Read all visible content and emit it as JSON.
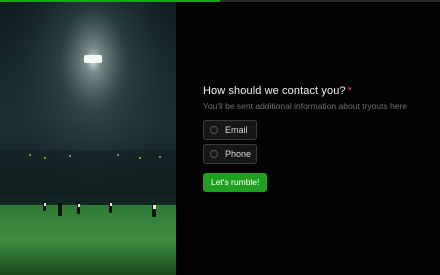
{
  "progress": {
    "fraction": 0.5,
    "fill_color": "#1ea31e",
    "track_color": "#2a2a2a"
  },
  "photo": {
    "subject": "floodlit-soccer-field-at-night"
  },
  "question": {
    "title": "How should we contact you?",
    "required_mark": "*",
    "subtitle": "You'll be sent additional information about tryouts here"
  },
  "choices": [
    {
      "label": "Email",
      "selected": false
    },
    {
      "label": "Phone",
      "selected": false
    }
  ],
  "submit": {
    "label": "Let's rumble!",
    "color": "#1fa01f"
  }
}
